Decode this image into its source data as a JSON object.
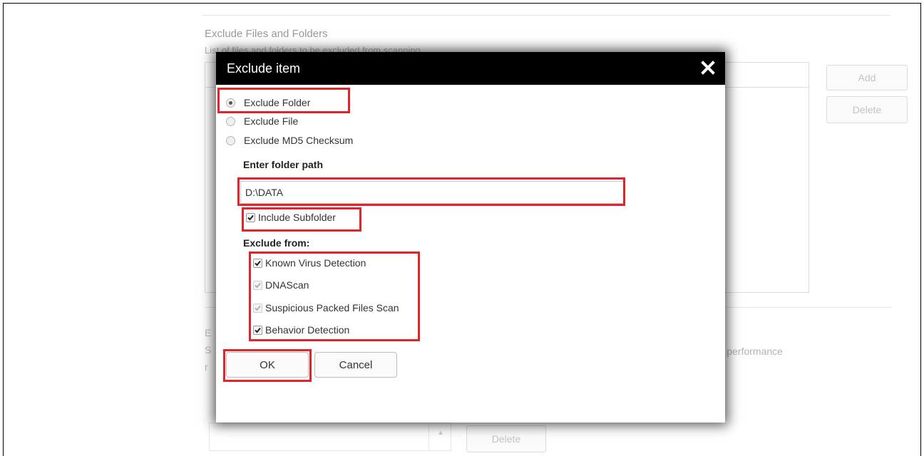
{
  "background": {
    "section_title": "Exclude Files and Folders",
    "section_description": "List of files and folders to be excluded from scanning",
    "add_button": "Add",
    "delete_button": "Delete",
    "frag_e": "E",
    "frag_s": "S",
    "frag_r": "r",
    "boot_text": "oot performance",
    "bottom_delete_button": "Delete"
  },
  "dialog": {
    "title": "Exclude item",
    "close_icon": "close-icon",
    "radios": [
      {
        "label": "Exclude Folder",
        "checked": true
      },
      {
        "label": "Exclude File",
        "checked": false
      },
      {
        "label": "Exclude MD5 Checksum",
        "checked": false
      }
    ],
    "path_label": "Enter folder path",
    "path_value": "D:\\DATA",
    "include_subfolder_label": "Include Subfolder",
    "exclude_from_label": "Exclude from:",
    "exclude_from": [
      {
        "label": "Known Virus Detection",
        "checked": true,
        "enabled": true
      },
      {
        "label": "DNAScan",
        "checked": true,
        "enabled": false
      },
      {
        "label": "Suspicious Packed Files Scan",
        "checked": true,
        "enabled": false
      },
      {
        "label": "Behavior Detection",
        "checked": true,
        "enabled": true
      }
    ],
    "ok_button": "OK",
    "cancel_button": "Cancel"
  },
  "colors": {
    "highlight": "#e0242a",
    "title_bar": "#000000"
  }
}
